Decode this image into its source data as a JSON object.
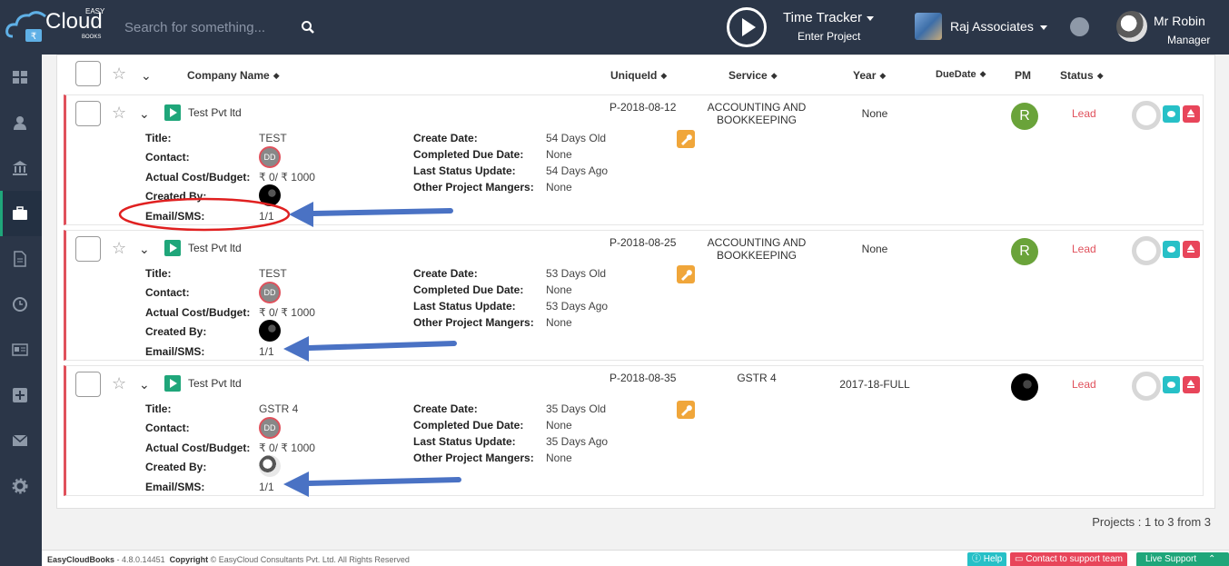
{
  "header": {
    "logo_top": "EASY",
    "logo_main": "Cloud",
    "logo_sub": "BOOKS",
    "search_placeholder": "Search for something...",
    "time_tracker": "Time Tracker",
    "enter_project": "Enter Project",
    "organization": "Raj Associates",
    "user_name": "Mr Robin",
    "user_role": "Manager"
  },
  "sidebar": {
    "items": [
      {
        "icon": "dashboard-icon"
      },
      {
        "icon": "user-icon"
      },
      {
        "icon": "bank-icon"
      },
      {
        "icon": "briefcase-icon",
        "active": true
      },
      {
        "icon": "document-icon"
      },
      {
        "icon": "clock-icon"
      },
      {
        "icon": "newspaper-icon"
      },
      {
        "icon": "plus-square-icon"
      },
      {
        "icon": "envelope-icon"
      },
      {
        "icon": "gear-icon"
      }
    ]
  },
  "table": {
    "columns": {
      "company": "Company Name",
      "uid": "UniqueId",
      "service": "Service",
      "year": "Year",
      "due": "DueDate",
      "pm": "PM",
      "status": "Status"
    },
    "labels": {
      "title": "Title:",
      "contact": "Contact:",
      "cost": "Actual Cost/Budget:",
      "created_by": "Created By:",
      "email": "Email/SMS:",
      "create_date": "Create Date:",
      "completed_due": "Completed Due Date:",
      "last_update": "Last Status Update:",
      "other_mgr": "Other Project Mangers:"
    },
    "rows": [
      {
        "company": "Test Pvt ltd",
        "uid": "P-2018-08-12",
        "service_line1": "ACCOUNTING AND",
        "service_line2": "BOOKKEEPING",
        "year": "None",
        "pm": "R",
        "status": "Lead",
        "title": "TEST",
        "contact": "DD",
        "cost": "₹ 0/ ₹ 1000",
        "email": "1/1",
        "create_date": "54 Days Old",
        "completed_due": "None",
        "last_update": "54 Days Ago",
        "other_mgr": "None"
      },
      {
        "company": "Test Pvt ltd",
        "uid": "P-2018-08-25",
        "service_line1": "ACCOUNTING AND",
        "service_line2": "BOOKKEEPING",
        "year": "None",
        "pm": "R",
        "status": "Lead",
        "title": "TEST",
        "contact": "DD",
        "cost": "₹ 0/ ₹ 1000",
        "email": "1/1",
        "create_date": "53 Days Old",
        "completed_due": "None",
        "last_update": "53 Days Ago",
        "other_mgr": "None"
      },
      {
        "company": "Test Pvt ltd",
        "uid": "P-2018-08-35",
        "service_line1": "GSTR 4",
        "service_line2": "",
        "year": "2017-18-FULL",
        "pm": "",
        "status": "Lead",
        "title": "GSTR 4",
        "contact": "DD",
        "cost": "₹ 0/ ₹ 1000",
        "email": "1/1",
        "create_date": "35 Days Old",
        "completed_due": "None",
        "last_update": "35 Days Ago",
        "other_mgr": "None"
      }
    ]
  },
  "pager": "Projects : 1 to 3 from 3",
  "footer": {
    "brand": "EasyCloudBooks",
    "version": "- 4.8.0.14451",
    "copyright_label": "Copyright",
    "copyright": "© EasyCloud Consultants Pvt. Ltd. All Rights Reserved",
    "help": "Help",
    "contact": "Contact to support team",
    "live": "Live Support"
  },
  "colors": {
    "header_bg": "#2b3648",
    "accent_green": "#1fa67a",
    "lead_red": "#e0515c",
    "wrench_orange": "#f0a63a",
    "annotation_blue": "#4a72c4",
    "annotation_red": "#e02020"
  }
}
